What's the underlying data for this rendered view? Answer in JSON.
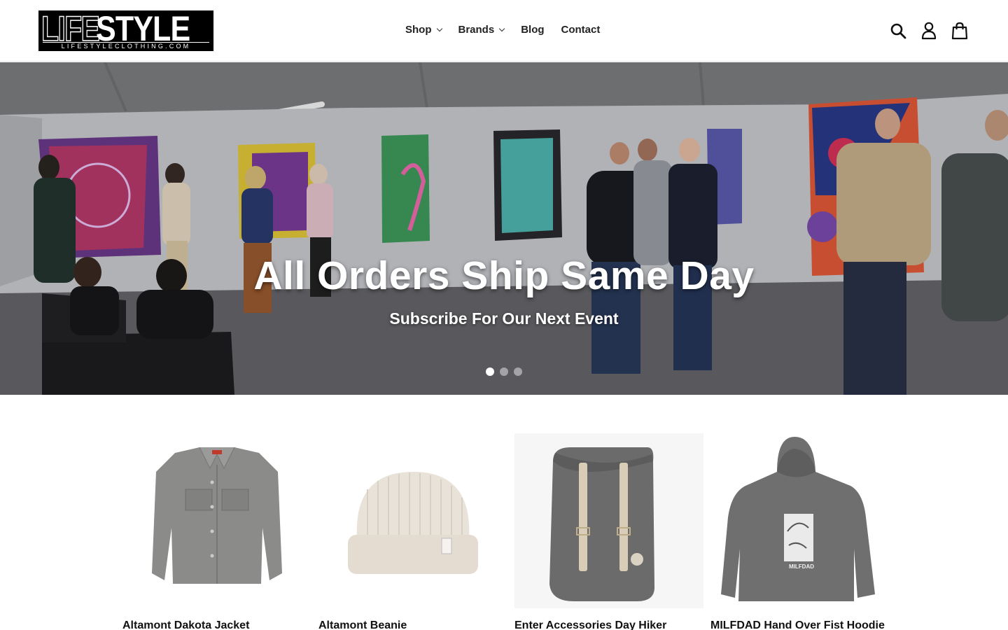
{
  "logo": {
    "outline_text": "LIFE",
    "solid_text": "STYLE",
    "sub_text": "LIFESTYLECLOTHING.COM"
  },
  "nav": [
    {
      "label": "Shop",
      "dropdown": true
    },
    {
      "label": "Brands",
      "dropdown": true
    },
    {
      "label": "Blog",
      "dropdown": false
    },
    {
      "label": "Contact",
      "dropdown": false
    }
  ],
  "header_icons": [
    "search-icon",
    "account-icon",
    "cart-icon"
  ],
  "hero": {
    "title": "All Orders Ship Same Day",
    "subtitle": "Subscribe For Our Next Event",
    "slides": 3,
    "active_slide": 1
  },
  "products": [
    {
      "title": "Altamont Dakota Jacket"
    },
    {
      "title": "Altamont Beanie"
    },
    {
      "title": "Enter Accessories Day Hiker"
    },
    {
      "title": "MILFDAD Hand Over Fist Hoodie",
      "print_text": "MILFDAD"
    }
  ],
  "colors": {
    "accent": "#000000",
    "nav_text": "#222222",
    "hero_text": "#ffffff"
  }
}
